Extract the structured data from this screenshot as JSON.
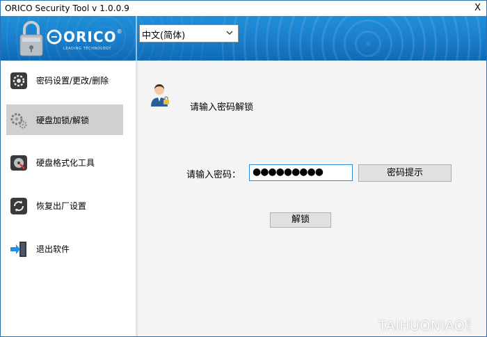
{
  "window": {
    "title": "ORICO Security Tool v 1.0.0.9",
    "close_label": "X"
  },
  "header": {
    "brand": "ORICO",
    "brand_mark": "®",
    "tagline": "LEADING TECHNOLOGY",
    "language": {
      "selected": "中文(简体)"
    },
    "colors": {
      "accent": "#1a7fcc",
      "accent_dark": "#0f6ab5"
    }
  },
  "sidebar": {
    "items": [
      {
        "label": "密码设置/更改/删除",
        "icon": "settings-icon",
        "active": false
      },
      {
        "label": "硬盘加锁/解锁",
        "icon": "gears-icon",
        "active": true
      },
      {
        "label": "硬盘格式化工具",
        "icon": "disk-format-icon",
        "active": false
      },
      {
        "label": "恢复出厂设置",
        "icon": "restore-icon",
        "active": false
      },
      {
        "label": "退出软件",
        "icon": "exit-icon",
        "active": false
      }
    ]
  },
  "main": {
    "heading": "请输入密码解锁",
    "password_label": "请输入密码：",
    "password_value": "●●●●●●●●●",
    "hint_button": "密码提示",
    "unlock_button": "解锁"
  },
  "watermark": {
    "text": "TAIHUONIAO",
    "suffix": ".COM"
  }
}
